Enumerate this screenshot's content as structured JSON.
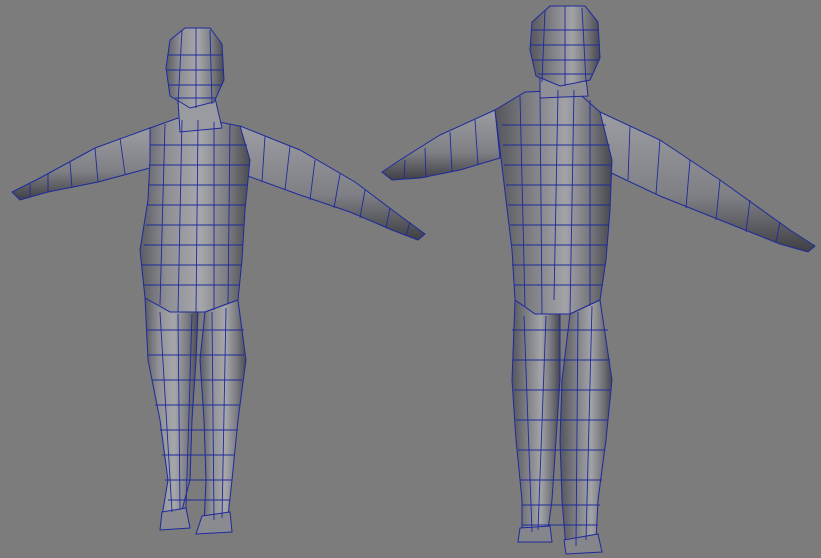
{
  "viewport": {
    "background": "#7c7c7c",
    "shading": "smooth-shade-with-wireframe-on-shaded"
  },
  "models": [
    {
      "name": "low-poly-human-front-view",
      "view": "front",
      "pose": "T-pose"
    },
    {
      "name": "low-poly-human-back-view",
      "view": "back",
      "pose": "T-pose"
    }
  ],
  "colors": {
    "wireframe": "#1f2a9c",
    "surface_light": "#a4a4a8",
    "surface_mid": "#8e8f94",
    "surface_dark": "#5d5e64",
    "surface_shadow": "#3f4045"
  }
}
